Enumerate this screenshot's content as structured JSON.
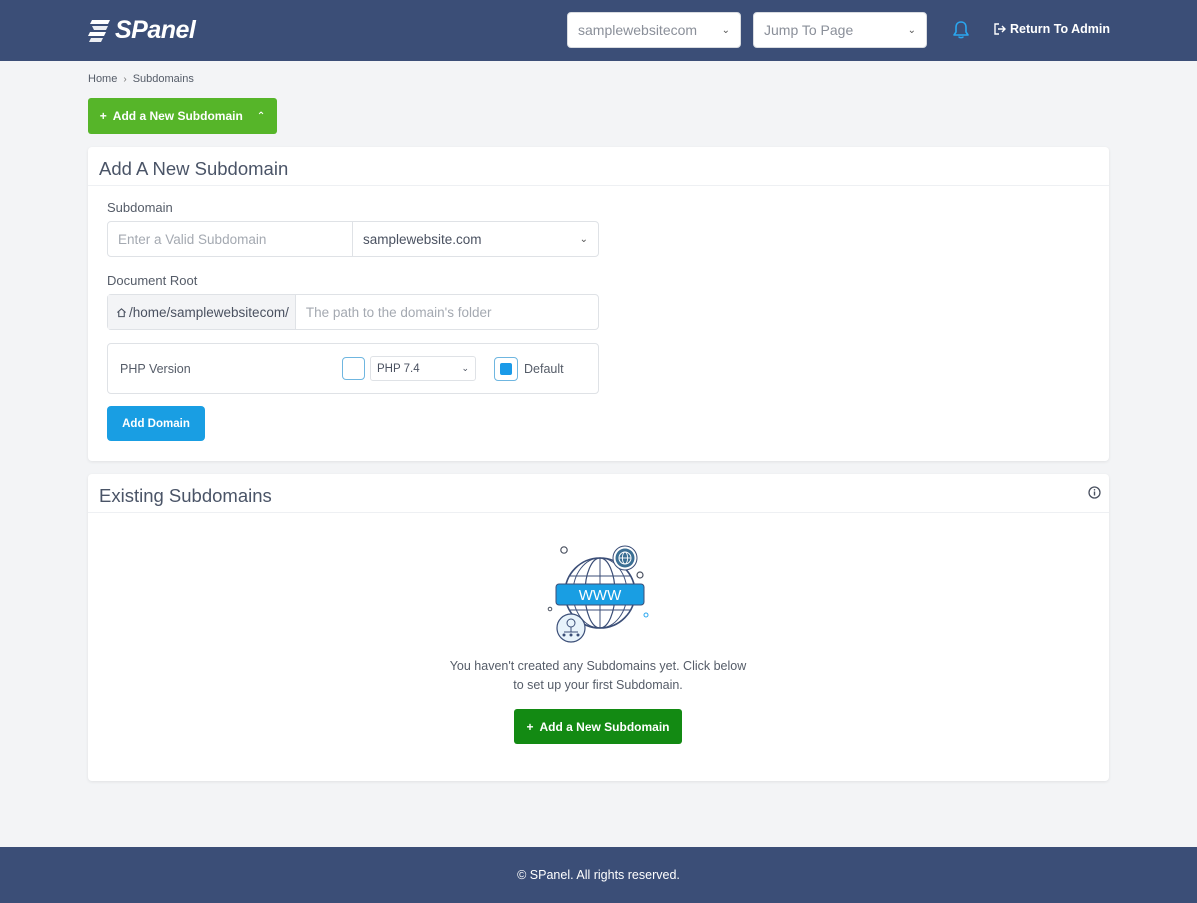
{
  "header": {
    "logo_text": "SPanel",
    "site_select": "samplewebsitecom",
    "jump_select": "Jump To Page",
    "return_admin": "Return To Admin",
    "icons": {
      "bell": "bell-icon",
      "exit": "sign-out-icon",
      "logo": "spanel-logo-icon"
    }
  },
  "breadcrumb": {
    "home": "Home",
    "current": "Subdomains"
  },
  "toggle_button": {
    "label": "Add a New Subdomain",
    "plus": "+"
  },
  "add_card": {
    "title": "Add A New Subdomain",
    "subdomain_label": "Subdomain",
    "subdomain_placeholder": "Enter a Valid Subdomain",
    "domain_value": "samplewebsite.com",
    "docroot_label": "Document Root",
    "docroot_prefix": "/home/samplewebsitecom/",
    "docroot_placeholder": "The path to the domain's folder",
    "php_label": "PHP Version",
    "php_value": "PHP 7.4",
    "default_label": "Default",
    "default_checked": true,
    "submit_label": "Add Domain"
  },
  "existing_card": {
    "title": "Existing Subdomains",
    "illustration_text": "WWW",
    "empty_message": "You haven't created any Subdomains yet. Click below to set up your first Subdomain.",
    "button_label": "Add a New Subdomain",
    "plus": "+"
  },
  "footer": {
    "text": "© SPanel. All rights reserved."
  },
  "colors": {
    "header_bg": "#3b4e77",
    "primary_blue": "#199ee3",
    "green": "#56b529",
    "dark_green": "#138a13"
  }
}
